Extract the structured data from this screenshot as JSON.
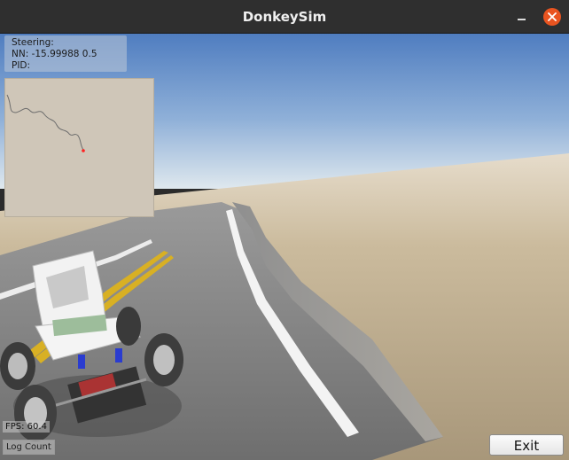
{
  "window": {
    "title": "DonkeySim"
  },
  "hud": {
    "steering_label": "Steering:",
    "nn_label": "NN: -15.99988 0.5",
    "pid_label": "PID:"
  },
  "stats": {
    "fps_label": "FPS: 60.4",
    "log_count_label": "Log Count"
  },
  "controls": {
    "exit_label": "Exit"
  },
  "colors": {
    "titlebar": "#2f2f2f",
    "close_button": "#e95420",
    "sky_top": "#5b84c4",
    "sky_horizon": "#d7e3ec",
    "desert": "#bfae8f",
    "road": "#8a8a8a",
    "lane_yellow": "#e0b21e",
    "map_background": "#cfc6b8",
    "map_marker": "#ff2020"
  }
}
